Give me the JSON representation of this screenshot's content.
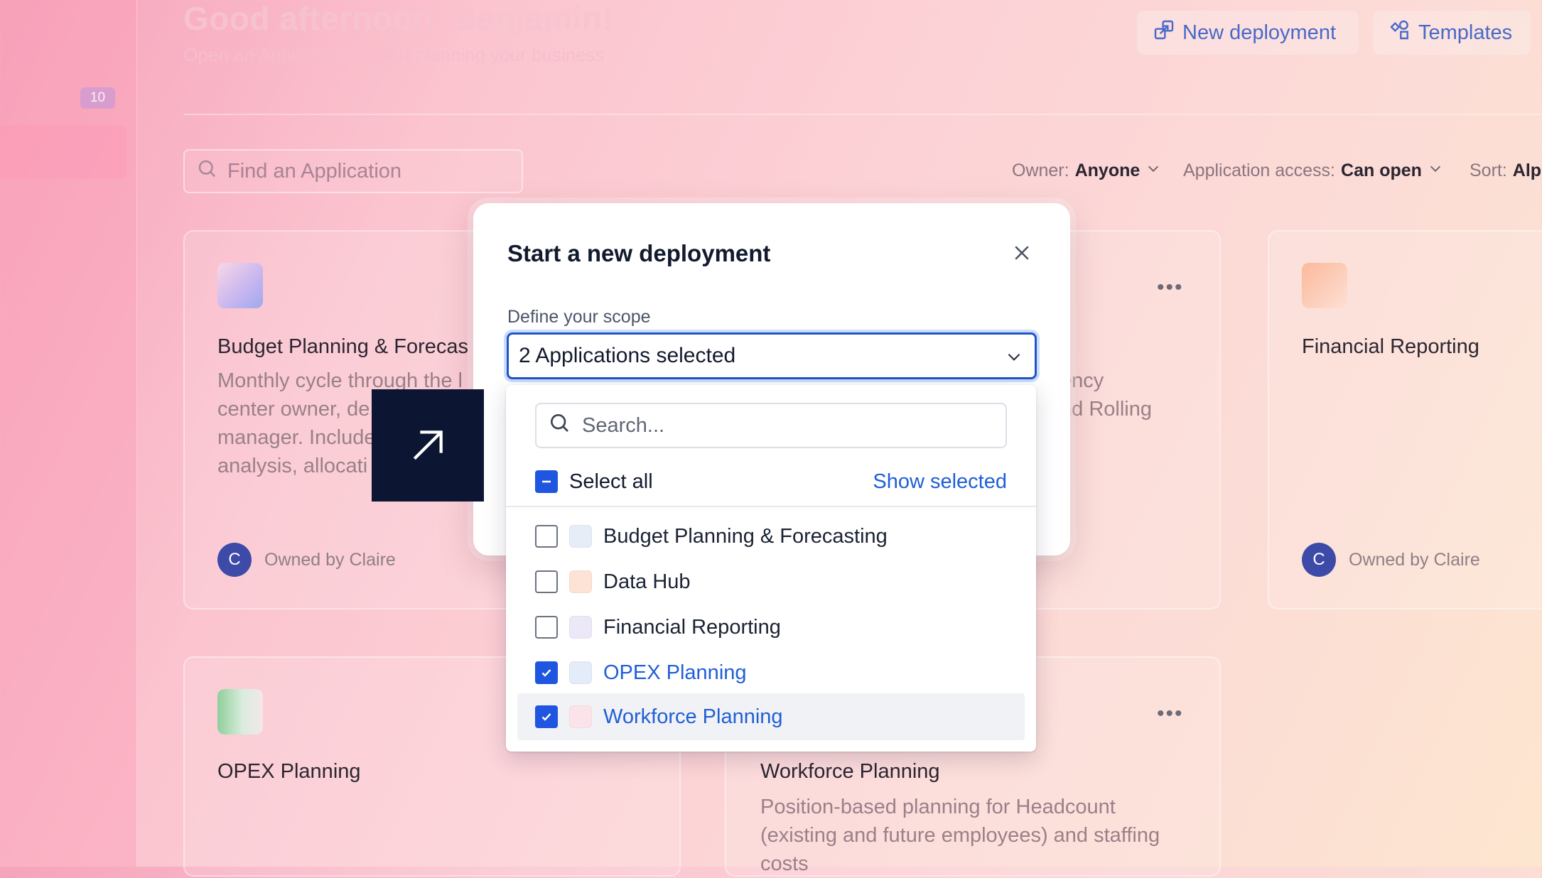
{
  "header": {
    "greeting": "Good afternoon, Benjamin!",
    "subtitle": "Open an Application to start planning your business",
    "new_deployment_label": "New deployment",
    "templates_label": "Templates"
  },
  "sidebar": {
    "badge": "10"
  },
  "search": {
    "placeholder": "Find an Application"
  },
  "filters": {
    "owner_label": "Owner:",
    "owner_value": "Anyone",
    "access_label": "Application access:",
    "access_value": "Can open",
    "sort_label": "Sort:",
    "sort_value": "Alp"
  },
  "cards": [
    {
      "title": "Budget Planning & Forecas",
      "desc": [
        "Monthly cycle through the l",
        "center owner, de",
        "manager. Include",
        "analysis, allocati"
      ],
      "owner": "Owned by Claire",
      "avatar": "C"
    },
    {
      "desc": [
        "ency",
        "nd Rolling"
      ]
    },
    {
      "title": "Financial Reporting",
      "owner": "Owned by Claire",
      "avatar": "C"
    },
    {
      "title": "OPEX Planning"
    },
    {
      "title": "Workforce Planning",
      "desc": [
        "Position-based planning for Headcount",
        "(existing and future employees) and staffing",
        "costs"
      ]
    }
  ],
  "modal": {
    "title": "Start a new deployment",
    "scope_label": "Define your scope",
    "scope_value": "2 Applications selected",
    "dropdown": {
      "search_placeholder": "Search...",
      "select_all": "Select all",
      "show_selected": "Show selected",
      "items": [
        {
          "label": "Budget Planning & Forecasting",
          "checked": false,
          "color": "#e7edf7"
        },
        {
          "label": "Data Hub",
          "checked": false,
          "color": "#fde3d6"
        },
        {
          "label": "Financial Reporting",
          "checked": false,
          "color": "#ece8f8"
        },
        {
          "label": "OPEX Planning",
          "checked": true,
          "color": "#e3ecf8"
        },
        {
          "label": "Workforce Planning",
          "checked": true,
          "color": "#fbe3ea"
        }
      ]
    }
  }
}
